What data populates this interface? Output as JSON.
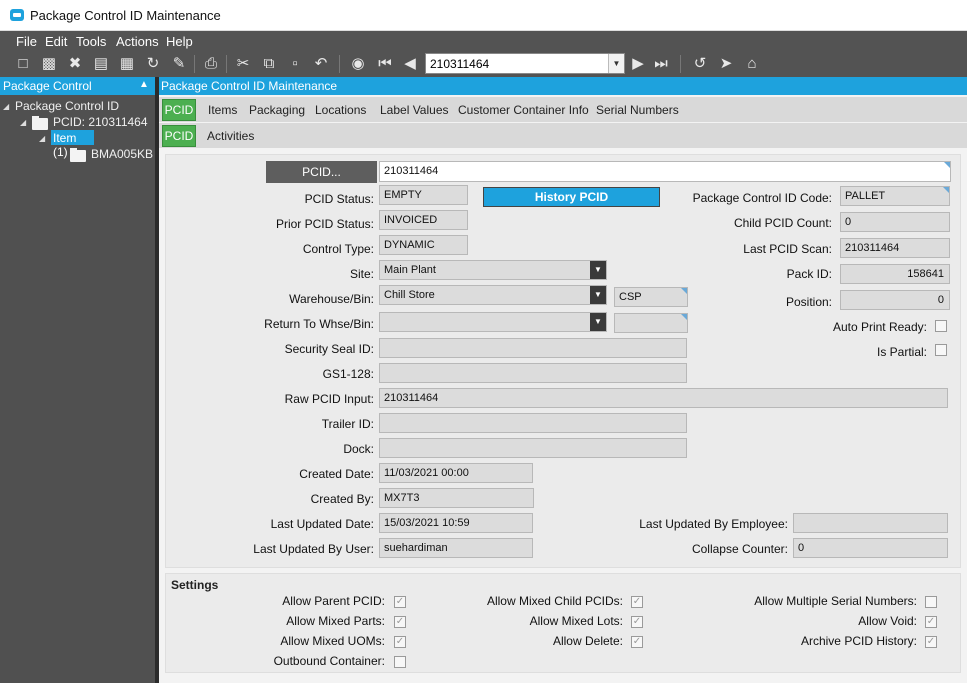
{
  "window": {
    "title": "Package Control ID Maintenance"
  },
  "menu": {
    "file": "File",
    "edit": "Edit",
    "tools": "Tools",
    "actions": "Actions",
    "help": "Help"
  },
  "toolbar": {
    "pcid_value": "210311464"
  },
  "tree": {
    "header": "Package Control",
    "root": "Package Control ID",
    "pcid_node": "PCID: 210311464",
    "item_node": "Item (1)",
    "part_node": "BMA005KB"
  },
  "main": {
    "header": "Package Control ID Maintenance",
    "tabs_row1": [
      "PCID",
      "Items",
      "Packaging",
      "Locations",
      "Label Values",
      "Customer Container Info",
      "Serial Numbers"
    ],
    "tabs_row2": [
      "PCID",
      "Activities"
    ]
  },
  "form": {
    "pcid_button": "PCID...",
    "pcid_value": "210311464",
    "history_button": "History PCID",
    "labels": {
      "pcid_status": "PCID Status:",
      "prior_status": "Prior PCID Status:",
      "control_type": "Control Type:",
      "site": "Site:",
      "warehouse_bin": "Warehouse/Bin:",
      "return_whse": "Return To Whse/Bin:",
      "security_seal": "Security Seal ID:",
      "gs1": "GS1-128:",
      "raw_pcid": "Raw PCID Input:",
      "trailer": "Trailer ID:",
      "dock": "Dock:",
      "created_date": "Created Date:",
      "created_by": "Created By:",
      "last_updated_date": "Last Updated Date:",
      "last_updated_user": "Last Updated By User:",
      "pkg_code": "Package Control ID Code:",
      "child_count": "Child PCID Count:",
      "last_scan": "Last PCID Scan:",
      "pack_id": "Pack ID:",
      "position": "Position:",
      "auto_print": "Auto Print Ready:",
      "is_partial": "Is Partial:",
      "last_updated_emp": "Last Updated By Employee:",
      "collapse_counter": "Collapse Counter:"
    },
    "values": {
      "pcid_status": "EMPTY",
      "prior_status": "INVOICED",
      "control_type": "DYNAMIC",
      "site": "Main Plant",
      "warehouse": "Chill Store",
      "bin": "CSP",
      "return_whse": "",
      "return_bin": "",
      "security_seal": "",
      "gs1": "",
      "raw_pcid": "210311464",
      "trailer": "",
      "dock": "",
      "created_date": "11/03/2021 00:00",
      "created_by": "MX7T3",
      "last_updated_date": "15/03/2021 10:59",
      "last_updated_user": "suehardiman",
      "pkg_code": "PALLET",
      "child_count": "0",
      "last_scan": "210311464",
      "pack_id": "158641",
      "position": "0",
      "last_updated_emp": "",
      "collapse_counter": "0"
    },
    "checks": {
      "auto_print": false,
      "is_partial": false
    }
  },
  "settings": {
    "title": "Settings",
    "items": [
      {
        "label": "Allow Parent PCID:",
        "checked": true
      },
      {
        "label": "Allow Mixed Parts:",
        "checked": true
      },
      {
        "label": "Allow Mixed UOMs:",
        "checked": true
      },
      {
        "label": "Outbound Container:",
        "checked": false
      },
      {
        "label": "Allow Mixed Child PCIDs:",
        "checked": true
      },
      {
        "label": "Allow Mixed Lots:",
        "checked": true
      },
      {
        "label": "Allow Delete:",
        "checked": true
      },
      {
        "label": "Allow Multiple Serial Numbers:",
        "checked": false
      },
      {
        "label": "Allow Void:",
        "checked": true
      },
      {
        "label": "Archive PCID History:",
        "checked": true
      }
    ]
  },
  "colors": {
    "accent": "#1ea2dd",
    "tab_active": "#4caf50",
    "dark_bg": "#535353"
  }
}
